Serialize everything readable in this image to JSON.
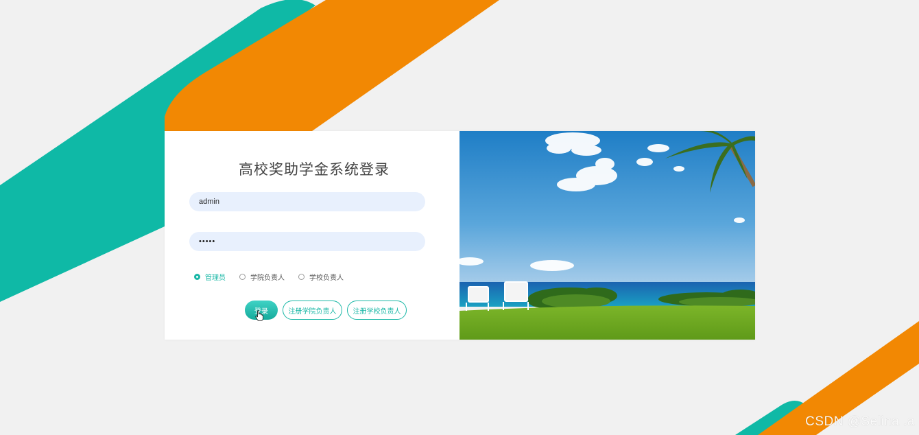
{
  "login": {
    "title": "高校奖助学金系统登录",
    "username_value": "admin",
    "password_value": "•••••",
    "roles": [
      {
        "label": "管理员",
        "checked": true
      },
      {
        "label": "学院负责人",
        "checked": false
      },
      {
        "label": "学校负责人",
        "checked": false
      }
    ],
    "buttons": {
      "login": "登录",
      "register_college": "注册学院负责人",
      "register_school": "注册学校负责人"
    }
  },
  "watermark": "CSDN @Selina .a",
  "colors": {
    "teal": "#0fb9a6",
    "orange": "#f28803",
    "background": "#f1f1f1",
    "input_bg": "#e8f0fd"
  }
}
